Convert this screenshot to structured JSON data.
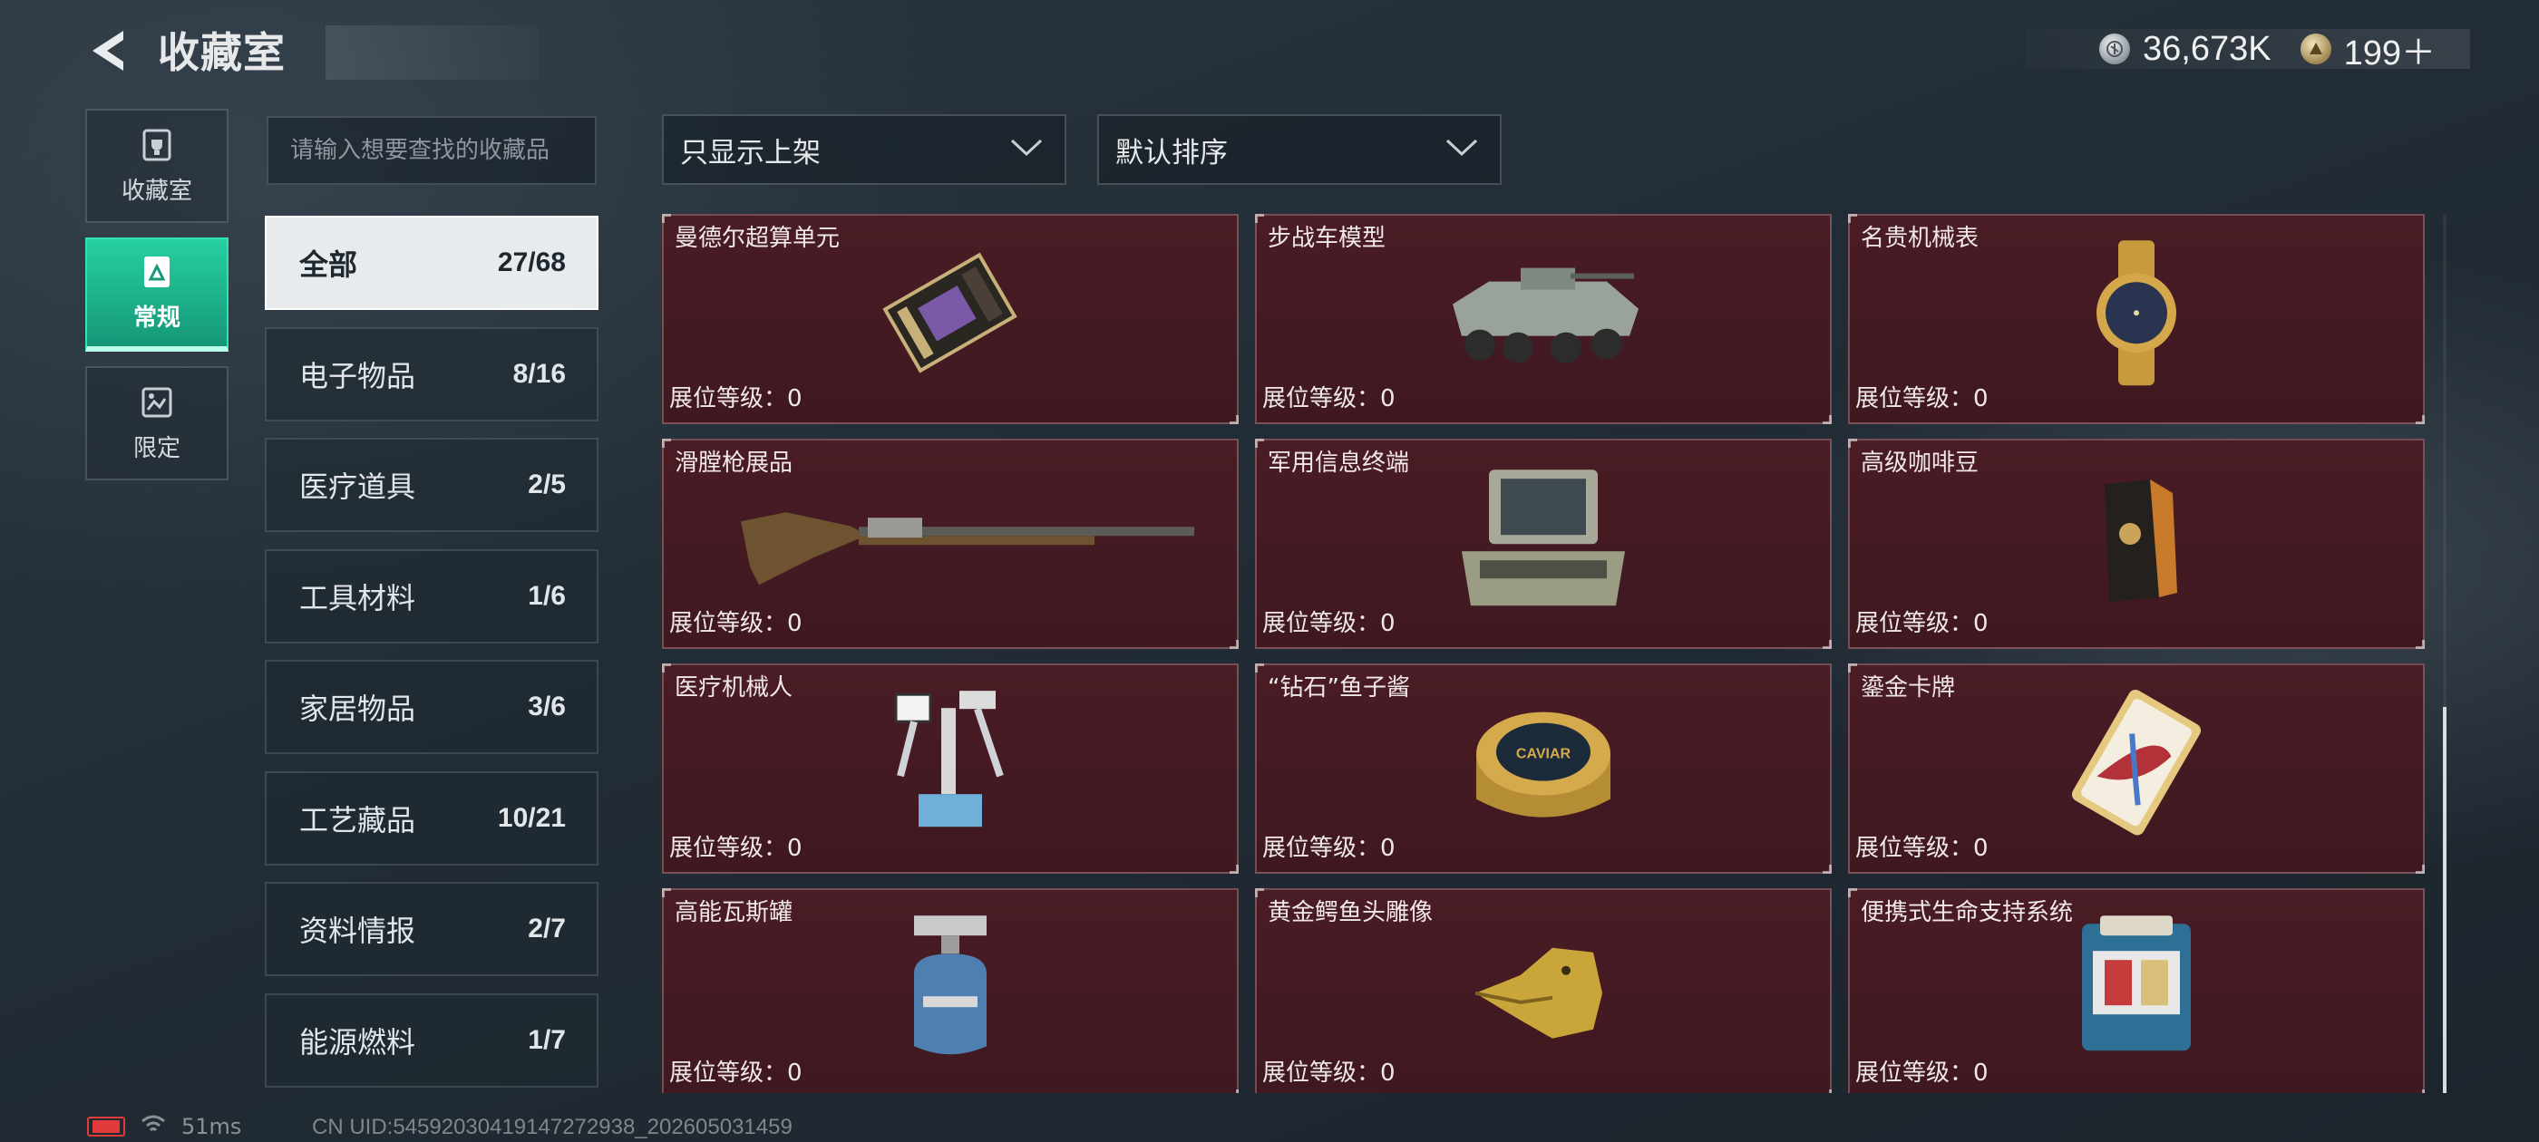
{
  "header": {
    "title": "收藏室",
    "currency": [
      {
        "icon": "silver-coin-icon",
        "value": "36,673K"
      },
      {
        "icon": "gold-coin-icon",
        "value": "199＋"
      }
    ]
  },
  "side_nav": [
    {
      "label": "收藏室",
      "icon": "trophy-icon",
      "active": false
    },
    {
      "label": "常规",
      "icon": "frame-icon",
      "active": true
    },
    {
      "label": "限定",
      "icon": "picture-icon",
      "active": false
    }
  ],
  "search": {
    "placeholder": "请输入想要查找的收藏品"
  },
  "filters": {
    "display": {
      "value": "只显示上架"
    },
    "sort": {
      "value": "默认排序"
    }
  },
  "categories": [
    {
      "label": "全部",
      "count": "27/68",
      "active": true
    },
    {
      "label": "电子物品",
      "count": "8/16"
    },
    {
      "label": "医疗道具",
      "count": "2/5"
    },
    {
      "label": "工具材料",
      "count": "1/6"
    },
    {
      "label": "家居物品",
      "count": "3/6"
    },
    {
      "label": "工艺藏品",
      "count": "10/21"
    },
    {
      "label": "资料情报",
      "count": "2/7"
    },
    {
      "label": "能源燃料",
      "count": "1/7"
    }
  ],
  "items": [
    {
      "name": "曼德尔超算单元",
      "level": "展位等级：0",
      "icon": "compute-unit-icon"
    },
    {
      "name": "步战车模型",
      "level": "展位等级：0",
      "icon": "ifv-model-icon"
    },
    {
      "name": "名贵机械表",
      "level": "展位等级：0",
      "icon": "luxury-watch-icon"
    },
    {
      "name": "滑膛枪展品",
      "level": "展位等级：0",
      "icon": "musket-icon"
    },
    {
      "name": "军用信息终端",
      "level": "展位等级：0",
      "icon": "military-terminal-icon"
    },
    {
      "name": "高级咖啡豆",
      "level": "展位等级：0",
      "icon": "coffee-bag-icon"
    },
    {
      "name": "医疗机械人",
      "level": "展位等级：0",
      "icon": "medical-robot-icon"
    },
    {
      "name": "“钻石”鱼子酱",
      "level": "展位等级：0",
      "icon": "caviar-tin-icon"
    },
    {
      "name": "鎏金卡牌",
      "level": "展位等级：0",
      "icon": "gilded-card-icon"
    },
    {
      "name": "高能瓦斯罐",
      "level": "展位等级：0",
      "icon": "gas-canister-icon"
    },
    {
      "name": "黄金鳄鱼头雕像",
      "level": "展位等级：0",
      "icon": "gold-crocodile-icon"
    },
    {
      "name": "便携式生命支持系统",
      "level": "展位等级：0",
      "icon": "life-support-icon"
    }
  ],
  "caviar_label": "CAVIAR",
  "status": {
    "ping": "51ms",
    "uid": "CN UID:54592030419147272938_202605031459"
  }
}
